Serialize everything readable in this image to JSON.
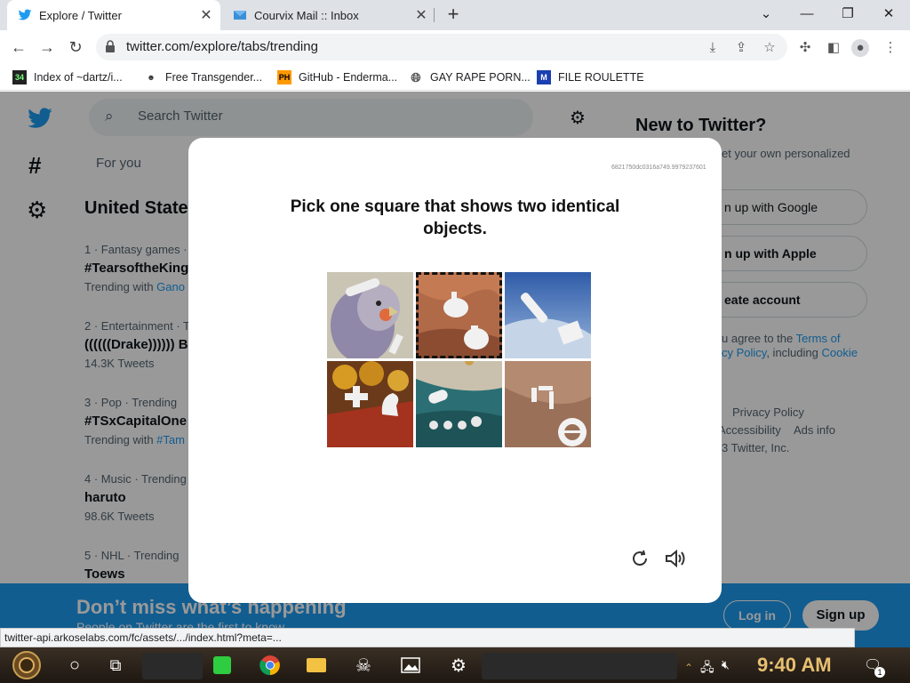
{
  "browser": {
    "tabs": [
      {
        "title": "Explore / Twitter",
        "active": true
      },
      {
        "title": "Courvix Mail :: Inbox",
        "active": false
      }
    ],
    "url": "twitter.com/explore/tabs/trending",
    "bookmarks": [
      "Index of ~dartz/i...",
      "Free Transgender...",
      "GitHub - Enderma...",
      "GAY RAPE PORN...",
      "FILE ROULETTE"
    ],
    "status_url": "twitter-api.arkoselabs.com/fc/assets/.../index.html?meta=..."
  },
  "twitter": {
    "search_placeholder": "Search Twitter",
    "for_you": "For you",
    "location_heading": "United State",
    "trends": [
      {
        "meta": "1 · Fantasy games · ",
        "title": "#TearsoftheKing",
        "sub": "Trending with ",
        "sub_link": "Gano"
      },
      {
        "meta": "2 · Entertainment · T",
        "title": "((((((Drake)))))) Be",
        "sub": "14.3K Tweets",
        "sub_link": ""
      },
      {
        "meta": "3 · Pop · Trending",
        "title": "#TSxCapitalOne",
        "sub": "Trending with ",
        "sub_link": "#Tam"
      },
      {
        "meta": "4 · Music · Trending",
        "title": "haruto",
        "sub": "98.6K Tweets",
        "sub_link": ""
      },
      {
        "meta": "5 · NHL · Trending",
        "title": "Toews",
        "sub": "",
        "sub_link": ""
      }
    ],
    "right": {
      "heading": "New to Twitter?",
      "sub": "et your own personalized",
      "google": "n up with Google",
      "apple": "n up with Apple",
      "create": "eate account",
      "terms_prefix": "u agree to the ",
      "terms_link": "Terms of",
      "privacy_line": "cy Policy",
      "including": ", including ",
      "cookie": "Cookie",
      "footer1": "Privacy Policy",
      "footer2": "Accessibility",
      "footer3": "Ads info",
      "footer4": "3 Twitter, Inc."
    },
    "banner": {
      "title": "Don’t miss what’s happening",
      "sub": "People on Twitter are the first to know.",
      "login": "Log in",
      "signup": "Sign up"
    }
  },
  "captcha": {
    "session_id": "6821750dc0316a749.9979237601",
    "prompt": "Pick one square that shows two identical objects.",
    "selected_index": 1
  },
  "taskbar": {
    "time": "9:40 AM",
    "notif_count": "1"
  },
  "colors": {
    "twitter_blue": "#1d9bf0",
    "chrome_strip": "#dee1e6"
  }
}
